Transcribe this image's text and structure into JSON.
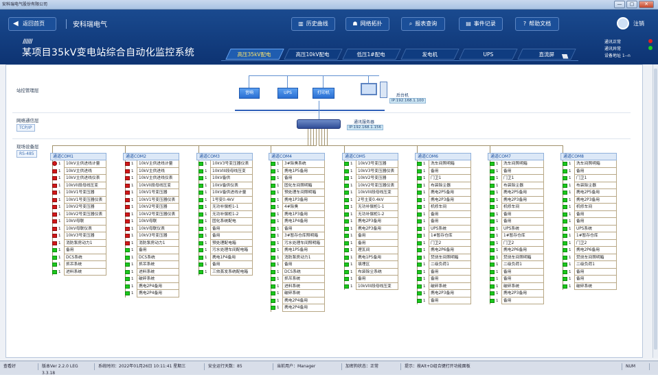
{
  "window": {
    "title": "安科瑞电气股份有限公司",
    "min": "—",
    "max": "▢",
    "close": "✕"
  },
  "header": {
    "back_label": "返回首页",
    "brand": "安科瑞电气",
    "nav": [
      {
        "label": "历史曲线",
        "icon": "chart-icon"
      },
      {
        "label": "网络拓扑",
        "icon": "topology-icon"
      },
      {
        "label": "报表查询",
        "icon": "search-icon"
      },
      {
        "label": "事件记录",
        "icon": "document-icon"
      },
      {
        "label": "帮助文档",
        "icon": "help-icon"
      }
    ],
    "user_label": "注销",
    "stripes": "//////",
    "title": "某项目35kV变电站综合自动化监控系统",
    "tabs": [
      "高压35kV配电",
      "高压10kV配电",
      "低压1#配电",
      "发电机",
      "UPS",
      "直流屏"
    ],
    "active_tab": 0,
    "status": [
      {
        "label": "通讯正常",
        "color": "#e02020"
      },
      {
        "label": "通讯异常",
        "color": "#20d020"
      },
      {
        "label": "设备地址  1--n",
        "color": ""
      }
    ],
    "chevrons": "\\\\\\\\\\\\\\\\"
  },
  "sections": {
    "station": "站控管理层",
    "network": "网络通信层",
    "network_tag": "TCP/IP",
    "field": "现场设备层",
    "field_tag": "RS-485"
  },
  "devices": {
    "d1": "音响",
    "d2": "UPS",
    "d3": "打印机"
  },
  "pc": {
    "label": "后台机",
    "ip": "IP:192.168.1.100"
  },
  "server": {
    "label": "通讯服务器",
    "ip": "IP:192.168.1.156"
  },
  "colors": {
    "ok": "#1cc71c",
    "fault": "#d11818"
  },
  "coms": [
    {
      "title": "通道COM1",
      "rows": [
        {
          "s": "rc",
          "n": "1",
          "l": "10kV主供进线计量"
        },
        {
          "s": "r",
          "n": "1",
          "l": "10kV主供进线"
        },
        {
          "s": "r",
          "n": "1",
          "l": "10kV主供进线仪表"
        },
        {
          "s": "r",
          "n": "1",
          "l": "10kVII段母线压变"
        },
        {
          "s": "r",
          "n": "1",
          "l": "10kV1号变压器"
        },
        {
          "s": "r",
          "n": "1",
          "l": "10kV1号变压器仪表"
        },
        {
          "s": "r",
          "n": "1",
          "l": "10kV2号变压器"
        },
        {
          "s": "r",
          "n": "1",
          "l": "10kV2号变压器仪表"
        },
        {
          "s": "r",
          "n": "1",
          "l": "10kV母联"
        },
        {
          "s": "r",
          "n": "1",
          "l": "10kV母联仪表"
        },
        {
          "s": "r",
          "n": "1",
          "l": "10kV3号变压器"
        },
        {
          "s": "r",
          "n": "1",
          "l": "消防泵房动力1"
        },
        {
          "s": "g",
          "n": "1",
          "l": "备用"
        },
        {
          "s": "g",
          "n": "1",
          "l": "DCS系统"
        },
        {
          "s": "g",
          "n": "1",
          "l": "抓吊系统"
        },
        {
          "s": "g",
          "n": "1",
          "l": "进料系统"
        }
      ]
    },
    {
      "title": "通道COM2",
      "rows": [
        {
          "s": "r",
          "n": "1",
          "l": "10kV主供进线计量"
        },
        {
          "s": "r",
          "n": "1",
          "l": "10kV主供进线"
        },
        {
          "s": "r",
          "n": "1",
          "l": "10kV主供进线仪表"
        },
        {
          "s": "r",
          "n": "1",
          "l": "10kVII段母线压变"
        },
        {
          "s": "r",
          "n": "1",
          "l": "10kV1号变压器"
        },
        {
          "s": "r",
          "n": "1",
          "l": "10kV1号变压器仪表"
        },
        {
          "s": "r",
          "n": "1",
          "l": "10kV2号变压器"
        },
        {
          "s": "r",
          "n": "1",
          "l": "10kV2号变压器仪表"
        },
        {
          "s": "r",
          "n": "1",
          "l": "10kV母联"
        },
        {
          "s": "r",
          "n": "1",
          "l": "10kV母联仪表"
        },
        {
          "s": "r",
          "n": "1",
          "l": "10kV3号变压器"
        },
        {
          "s": "r",
          "n": "1",
          "l": "消防泵房动力1"
        },
        {
          "s": "g",
          "n": "1",
          "l": "备用"
        },
        {
          "s": "g",
          "n": "1",
          "l": "DCS系统"
        },
        {
          "s": "g",
          "n": "1",
          "l": "抓吊系统"
        },
        {
          "s": "g",
          "n": "1",
          "l": "进料系统"
        },
        {
          "s": "g",
          "n": "1",
          "l": "破碎系统"
        },
        {
          "s": "g",
          "n": "1",
          "l": "携电2P4备用"
        },
        {
          "s": "g",
          "n": "1",
          "l": "携电2P4备用"
        }
      ]
    },
    {
      "title": "通道COM3",
      "rows": [
        {
          "s": "g",
          "n": "1",
          "l": "10kV3号变压器仪表"
        },
        {
          "s": "g",
          "n": "1",
          "l": "10kVIII段母线压变"
        },
        {
          "s": "g",
          "n": "1",
          "l": "10kV备供"
        },
        {
          "s": "g",
          "n": "1",
          "l": "10kV备供仪表"
        },
        {
          "s": "g",
          "n": "1",
          "l": "10kV备供进线计量"
        },
        {
          "s": "g",
          "n": "1",
          "l": "1号变0.4kV"
        },
        {
          "s": "g",
          "n": "1",
          "l": "无功补偿柜1-1"
        },
        {
          "s": "g",
          "n": "1",
          "l": "无功补偿柜1-2"
        },
        {
          "s": "g",
          "n": "1",
          "l": "固化系统配电"
        },
        {
          "s": "g",
          "n": "1",
          "l": "备用"
        },
        {
          "s": "g",
          "n": "1",
          "l": "备用"
        },
        {
          "s": "g",
          "n": "1",
          "l": "预处理配电箱"
        },
        {
          "s": "g",
          "n": "1",
          "l": "污水处理车间配电箱"
        },
        {
          "s": "g",
          "n": "1",
          "l": "携电1P4备用"
        },
        {
          "s": "g",
          "n": "1",
          "l": "备用"
        },
        {
          "s": "g",
          "n": "1",
          "l": "三效蒸发系统配电箱"
        }
      ]
    },
    {
      "title": "通道COM4",
      "rows": [
        {
          "s": "g",
          "n": "1",
          "l": "3#除臭系统"
        },
        {
          "s": "g",
          "n": "1",
          "l": "携电1P5备用"
        },
        {
          "s": "g",
          "n": "1",
          "l": "备用"
        },
        {
          "s": "g",
          "n": "1",
          "l": "固化车间照明箱"
        },
        {
          "s": "g",
          "n": "1",
          "l": "预处理车间照明箱"
        },
        {
          "s": "g",
          "n": "1",
          "l": "携电1P3备用"
        },
        {
          "s": "g",
          "n": "1",
          "l": "4#除臭"
        },
        {
          "s": "g",
          "n": "1",
          "l": "携电1P3备用"
        },
        {
          "s": "g",
          "n": "1",
          "l": "携电1P4备用"
        },
        {
          "s": "g",
          "n": "1",
          "l": "备用"
        },
        {
          "s": "g",
          "n": "1",
          "l": "3#暂存仓库照明箱"
        },
        {
          "s": "g",
          "n": "1",
          "l": "污水处理车间照明箱"
        },
        {
          "s": "g",
          "n": "1",
          "l": "携电1P5备用"
        },
        {
          "s": "g",
          "n": "1",
          "l": "消防泵房动力1"
        },
        {
          "s": "g",
          "n": "1",
          "l": "备用"
        },
        {
          "s": "g",
          "n": "1",
          "l": "DCS系统"
        },
        {
          "s": "g",
          "n": "1",
          "l": "抓吊系统"
        },
        {
          "s": "g",
          "n": "1",
          "l": "进料系统"
        },
        {
          "s": "g",
          "n": "1",
          "l": "破碎系统"
        },
        {
          "s": "g",
          "n": "1",
          "l": "携电2P4备用"
        },
        {
          "s": "g",
          "n": "1",
          "l": "携电2P4备用"
        }
      ]
    },
    {
      "title": "通道COM5",
      "rows": [
        {
          "s": "g",
          "n": "1",
          "l": "10kV3号变压器"
        },
        {
          "s": "g",
          "n": "1",
          "l": "10kV3号变压器仪表"
        },
        {
          "s": "g",
          "n": "1",
          "l": "10kV2号变压器"
        },
        {
          "s": "g",
          "n": "1",
          "l": "10kV2号变压器仪表"
        },
        {
          "s": "g",
          "n": "1",
          "l": "10kVIII段母线压变"
        },
        {
          "s": "g",
          "n": "1",
          "l": "2号主变0.4kV"
        },
        {
          "s": "g",
          "n": "1",
          "l": "无功补偿柜1-1"
        },
        {
          "s": "g",
          "n": "1",
          "l": "无功补偿柜1-2"
        },
        {
          "s": "g",
          "n": "1",
          "l": "携电2P3备用"
        },
        {
          "s": "g",
          "n": "1",
          "l": "携电2P3备用"
        },
        {
          "s": "g",
          "n": "1",
          "l": "备用"
        },
        {
          "s": "g",
          "n": "1",
          "l": "备用"
        },
        {
          "s": "g",
          "n": "1",
          "l": "理瓦间"
        },
        {
          "s": "g",
          "n": "1",
          "l": "携电1P5备用"
        },
        {
          "s": "g",
          "n": "1",
          "l": "填埋区"
        },
        {
          "s": "g",
          "n": "1",
          "l": "布袋除尘系统"
        },
        {
          "s": "g",
          "n": "1",
          "l": "备用"
        },
        {
          "s": "g",
          "n": "1",
          "l": "10kVIII段母线压变"
        }
      ]
    },
    {
      "title": "通道COM6",
      "rows": [
        {
          "s": "g",
          "n": "1",
          "l": "洗车间照明箱"
        },
        {
          "s": "g",
          "n": "1",
          "l": "备用"
        },
        {
          "s": "g",
          "n": "1",
          "l": "门卫1"
        },
        {
          "s": "g",
          "n": "1",
          "l": "布袋除尘器"
        },
        {
          "s": "g",
          "n": "1",
          "l": "携电2P5备用"
        },
        {
          "s": "g",
          "n": "1",
          "l": "携电2P3备用"
        },
        {
          "s": "g",
          "n": "1",
          "l": "机修车间"
        },
        {
          "s": "g",
          "n": "1",
          "l": "备用"
        },
        {
          "s": "g",
          "n": "1",
          "l": "备用"
        },
        {
          "s": "g",
          "n": "1",
          "l": "UPS系统"
        },
        {
          "s": "g",
          "n": "1",
          "l": "1#暂存仓库"
        },
        {
          "s": "g",
          "n": "1",
          "l": "门卫2"
        },
        {
          "s": "g",
          "n": "1",
          "l": "携电2P6备用"
        },
        {
          "s": "g",
          "n": "1",
          "l": "焚烧车间照明箱"
        },
        {
          "s": "g",
          "n": "1",
          "l": "二级负荷1"
        },
        {
          "s": "g",
          "n": "1",
          "l": "备用"
        },
        {
          "s": "g",
          "n": "1",
          "l": "备用"
        },
        {
          "s": "g",
          "n": "1",
          "l": "破碎系统"
        },
        {
          "s": "g",
          "n": "1",
          "l": "携电2P3备用"
        },
        {
          "s": "g",
          "n": "1",
          "l": "备用"
        }
      ]
    },
    {
      "title": "通道COM7",
      "rows": [
        {
          "s": "g",
          "n": "1",
          "l": "洗车间照明箱"
        },
        {
          "s": "g",
          "n": "1",
          "l": "备用"
        },
        {
          "s": "g",
          "n": "1",
          "l": "门卫1"
        },
        {
          "s": "g",
          "n": "1",
          "l": "布袋除尘器"
        },
        {
          "s": "g",
          "n": "1",
          "l": "携电2P5备用"
        },
        {
          "s": "g",
          "n": "1",
          "l": "携电2P3备用"
        },
        {
          "s": "g",
          "n": "1",
          "l": "机修车间"
        },
        {
          "s": "g",
          "n": "1",
          "l": "备用"
        },
        {
          "s": "g",
          "n": "1",
          "l": "备用"
        },
        {
          "s": "g",
          "n": "1",
          "l": "UPS系统"
        },
        {
          "s": "g",
          "n": "1",
          "l": "1#暂存仓库"
        },
        {
          "s": "g",
          "n": "1",
          "l": "门卫2"
        },
        {
          "s": "g",
          "n": "1",
          "l": "携电2P6备用"
        },
        {
          "s": "g",
          "n": "1",
          "l": "焚烧车间照明箱"
        },
        {
          "s": "g",
          "n": "1",
          "l": "二级负荷1"
        },
        {
          "s": "g",
          "n": "1",
          "l": "备用"
        },
        {
          "s": "g",
          "n": "1",
          "l": "备用"
        },
        {
          "s": "g",
          "n": "1",
          "l": "破碎系统"
        },
        {
          "s": "g",
          "n": "1",
          "l": "携电2P3备用"
        },
        {
          "s": "g",
          "n": "1",
          "l": "备用"
        }
      ]
    },
    {
      "title": "通道COM8",
      "rows": [
        {
          "s": "g",
          "n": "1",
          "l": "洗车间照明箱"
        },
        {
          "s": "g",
          "n": "1",
          "l": "备用"
        },
        {
          "s": "g",
          "n": "1",
          "l": "门卫1"
        },
        {
          "s": "g",
          "n": "1",
          "l": "布袋除尘器"
        },
        {
          "s": "g",
          "n": "1",
          "l": "携电2P5备用"
        },
        {
          "s": "g",
          "n": "1",
          "l": "携电2P3备用"
        },
        {
          "s": "g",
          "n": "1",
          "l": "机修车间"
        },
        {
          "s": "g",
          "n": "1",
          "l": "备用"
        },
        {
          "s": "g",
          "n": "1",
          "l": "备用"
        },
        {
          "s": "g",
          "n": "1",
          "l": "UPS系统"
        },
        {
          "s": "g",
          "n": "1",
          "l": "1#暂存仓库"
        },
        {
          "s": "g",
          "n": "1",
          "l": "门卫2"
        },
        {
          "s": "g",
          "n": "1",
          "l": "携电2P6备用"
        },
        {
          "s": "g",
          "n": "1",
          "l": "焚烧车间照明箱"
        },
        {
          "s": "g",
          "n": "1",
          "l": "二级负荷1"
        },
        {
          "s": "g",
          "n": "1",
          "l": "备用"
        },
        {
          "s": "g",
          "n": "1",
          "l": "备用"
        },
        {
          "s": "g",
          "n": "1",
          "l": "破碎系统"
        }
      ]
    }
  ],
  "footer": {
    "f1": "查看好",
    "f2": "版本Ver 2.2.0 LEG 3.3.18",
    "f3": "系统时间：2022年01月26日  10:11:41  星期三",
    "f4": "安全运行天数：85",
    "f5": "当前用户：Manager",
    "f6": "加密狗状态：正常",
    "f7": "提示：按Alt+D组合键打开功能面板",
    "f8": "NUM"
  }
}
